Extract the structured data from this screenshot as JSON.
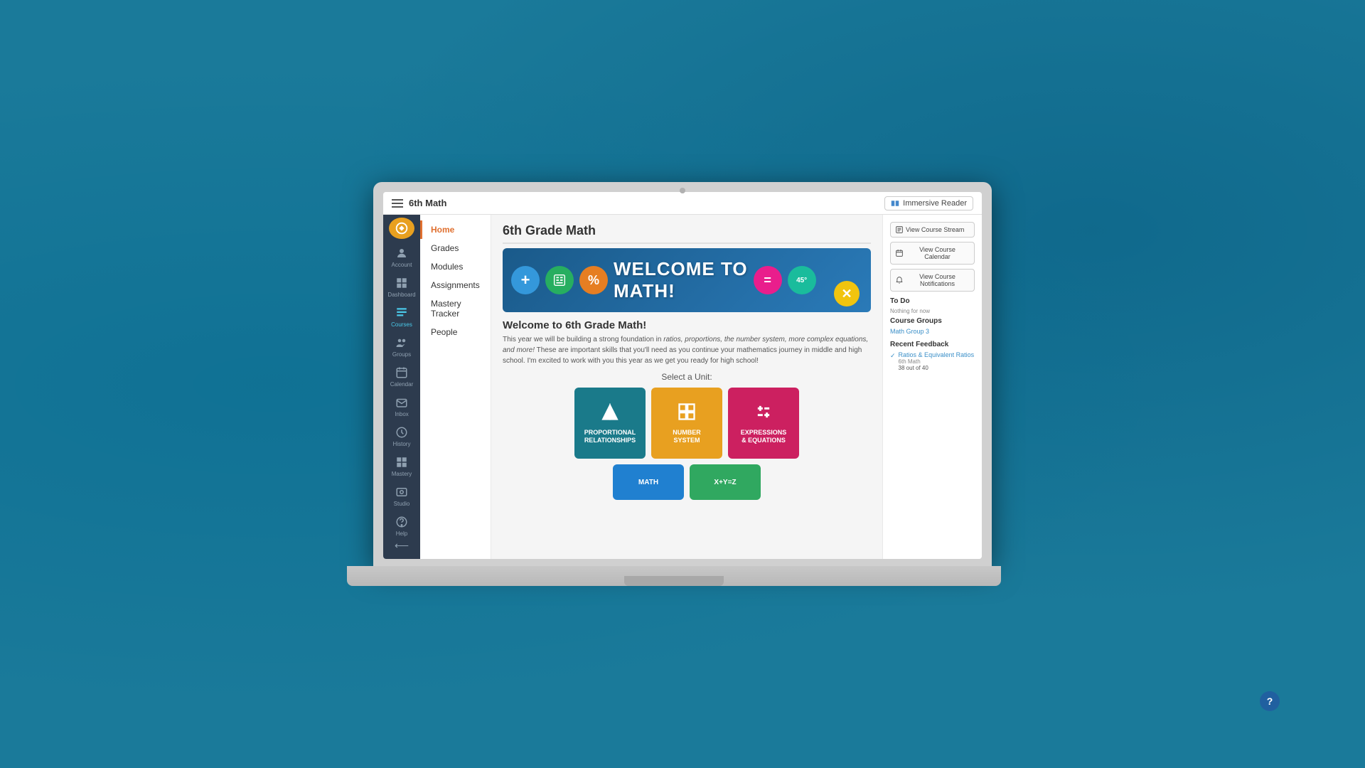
{
  "background": {
    "color": "#1a7a9a"
  },
  "topBar": {
    "title": "6th Math",
    "immersiveReader": "Immersive Reader"
  },
  "sidebar": {
    "items": [
      {
        "id": "account",
        "label": "Account",
        "icon": "👤"
      },
      {
        "id": "dashboard",
        "label": "Dashboard",
        "icon": "⊞"
      },
      {
        "id": "courses",
        "label": "Courses",
        "icon": "📋",
        "active": true
      },
      {
        "id": "groups",
        "label": "Groups",
        "icon": "👥"
      },
      {
        "id": "calendar",
        "label": "Calendar",
        "icon": "📅"
      },
      {
        "id": "inbox",
        "label": "Inbox",
        "icon": "✉"
      },
      {
        "id": "history",
        "label": "History",
        "icon": "🕐"
      },
      {
        "id": "mastery",
        "label": "Mastery",
        "icon": "⊞"
      },
      {
        "id": "studio",
        "label": "Studio",
        "icon": "📷"
      },
      {
        "id": "help",
        "label": "Help",
        "icon": "?"
      }
    ]
  },
  "leftNav": {
    "items": [
      {
        "id": "home",
        "label": "Home",
        "active": true
      },
      {
        "id": "grades",
        "label": "Grades"
      },
      {
        "id": "modules",
        "label": "Modules"
      },
      {
        "id": "assignments",
        "label": "Assignments"
      },
      {
        "id": "mastery",
        "label": "Mastery Tracker"
      },
      {
        "id": "people",
        "label": "People"
      }
    ]
  },
  "main": {
    "courseTitle": "6th Grade Math",
    "welcomeHeading": "Welcome to 6th Grade Math!",
    "welcomeText": "WELCOME TO\nMATH!",
    "description": "This year we will be building a strong foundation in ratios, proportions, the number system, more complex equations, and more! These are important skills that you'll need as you continue your mathematics journey in middle and high school.  I'm excited to work with you this year as we get you ready for high school!",
    "selectUnitLabel": "Select a Unit:",
    "units": [
      {
        "id": "proportional",
        "label": "PROPORTIONAL\nRELATIONSHIPS",
        "color": "#1a7a8a",
        "icon": "◑"
      },
      {
        "id": "number-system",
        "label": "NUMBER\nSYSTEM",
        "color": "#e8a020",
        "icon": "⊞"
      },
      {
        "id": "expressions",
        "label": "EXPRESSIONS\n& EQUATIONS",
        "color": "#cc2060",
        "icon": "⊞"
      }
    ],
    "units2": [
      {
        "id": "math",
        "label": "MATH",
        "color": "#2080d0"
      },
      {
        "id": "algebra",
        "label": "X+Y=Z",
        "color": "#30a860"
      }
    ]
  },
  "rightPanel": {
    "buttons": [
      {
        "id": "stream",
        "label": "View Course Stream"
      },
      {
        "id": "calendar",
        "label": "View Course Calendar"
      },
      {
        "id": "notifications",
        "label": "View Course Notifications"
      }
    ],
    "toDoTitle": "To Do",
    "nothingForNow": "Nothing for now",
    "courseGroupsTitle": "Course Groups",
    "groupLink": "Math Group 3",
    "recentFeedbackTitle": "Recent Feedback",
    "feedback": {
      "name": "Ratios & Equivalent Ratios",
      "course": "6th Math",
      "score": "38 out of 40"
    }
  },
  "questionBtn": "?"
}
